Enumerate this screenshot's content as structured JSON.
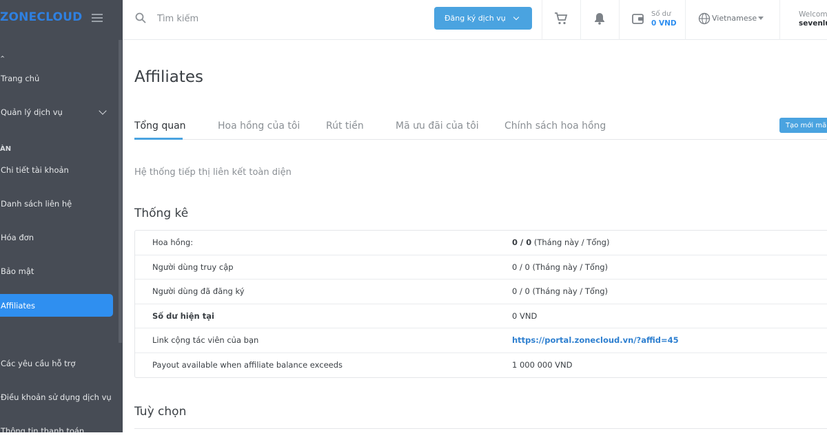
{
  "brand": {
    "logo_zone": "ZONE",
    "logo_cloud": "CLOUD",
    "accent": "#2f80e0"
  },
  "sidebar": {
    "sections": [
      {
        "label": ""
      },
      {
        "label": "ÀN"
      }
    ],
    "items": [
      {
        "label": "Trang chủ",
        "active": false
      },
      {
        "label": "Quản lý dịch vụ",
        "active": false,
        "has_submenu": true
      },
      {
        "label": "Chi tiết tài khoản",
        "active": false
      },
      {
        "label": "Danh sách liên hệ",
        "active": false
      },
      {
        "label": "Hóa đơn",
        "active": false
      },
      {
        "label": "Bảo mật",
        "active": false
      },
      {
        "label": "Affiliates",
        "active": true
      },
      {
        "label": "Các yêu cầu hỗ trợ",
        "active": false
      },
      {
        "label": "Điều khoản sử dụng dịch vụ",
        "active": false
      },
      {
        "label": "Thông tin thanh toán",
        "active": false
      }
    ]
  },
  "topbar": {
    "search_placeholder": "Tìm kiếm",
    "register_label": "Đăng ký dịch vụ",
    "balance_label": "Số dư",
    "balance_value": "0 VND",
    "language": "Vietnamese",
    "welcome": "Welcome",
    "username": "sevenlu"
  },
  "page": {
    "title": "Affiliates",
    "tabs": [
      {
        "label": "Tổng quan",
        "active": true
      },
      {
        "label": "Hoa hồng của tôi",
        "active": false
      },
      {
        "label": "Rút tiền",
        "active": false
      },
      {
        "label": "Mã ưu đãi của tôi",
        "active": false
      },
      {
        "label": "Chính sách hoa hồng",
        "active": false
      }
    ],
    "new_button": "Tạo mới mã",
    "subtitle": "Hệ thống tiếp thị liên kết toàn diện",
    "stats_title": "Thống kê",
    "stats": [
      {
        "label": "Hoa hồng:",
        "value_bold": "0 / 0",
        "value_rest": " (Tháng này / Tổng)",
        "label_bold": false
      },
      {
        "label": "Người dùng truy cập",
        "value_bold": "",
        "value_rest": "0 / 0 (Tháng này / Tổng)",
        "label_bold": false
      },
      {
        "label": "Người dùng đã đăng ký",
        "value_bold": "",
        "value_rest": "0 / 0 (Tháng này / Tổng)",
        "label_bold": false
      },
      {
        "label": "Số dư hiện tại",
        "value_bold": "",
        "value_rest": "0 VND",
        "label_bold": true
      },
      {
        "label": "Link cộng tác viên của bạn",
        "value_bold": "",
        "value_rest": "https://portal.zonecloud.vn/?affid=45",
        "label_bold": false,
        "is_link": true
      },
      {
        "label": "Payout available when affiliate balance exceeds",
        "value_bold": "",
        "value_rest": "1 000 000 VND",
        "label_bold": false
      }
    ],
    "options_title": "Tuỳ chọn"
  }
}
